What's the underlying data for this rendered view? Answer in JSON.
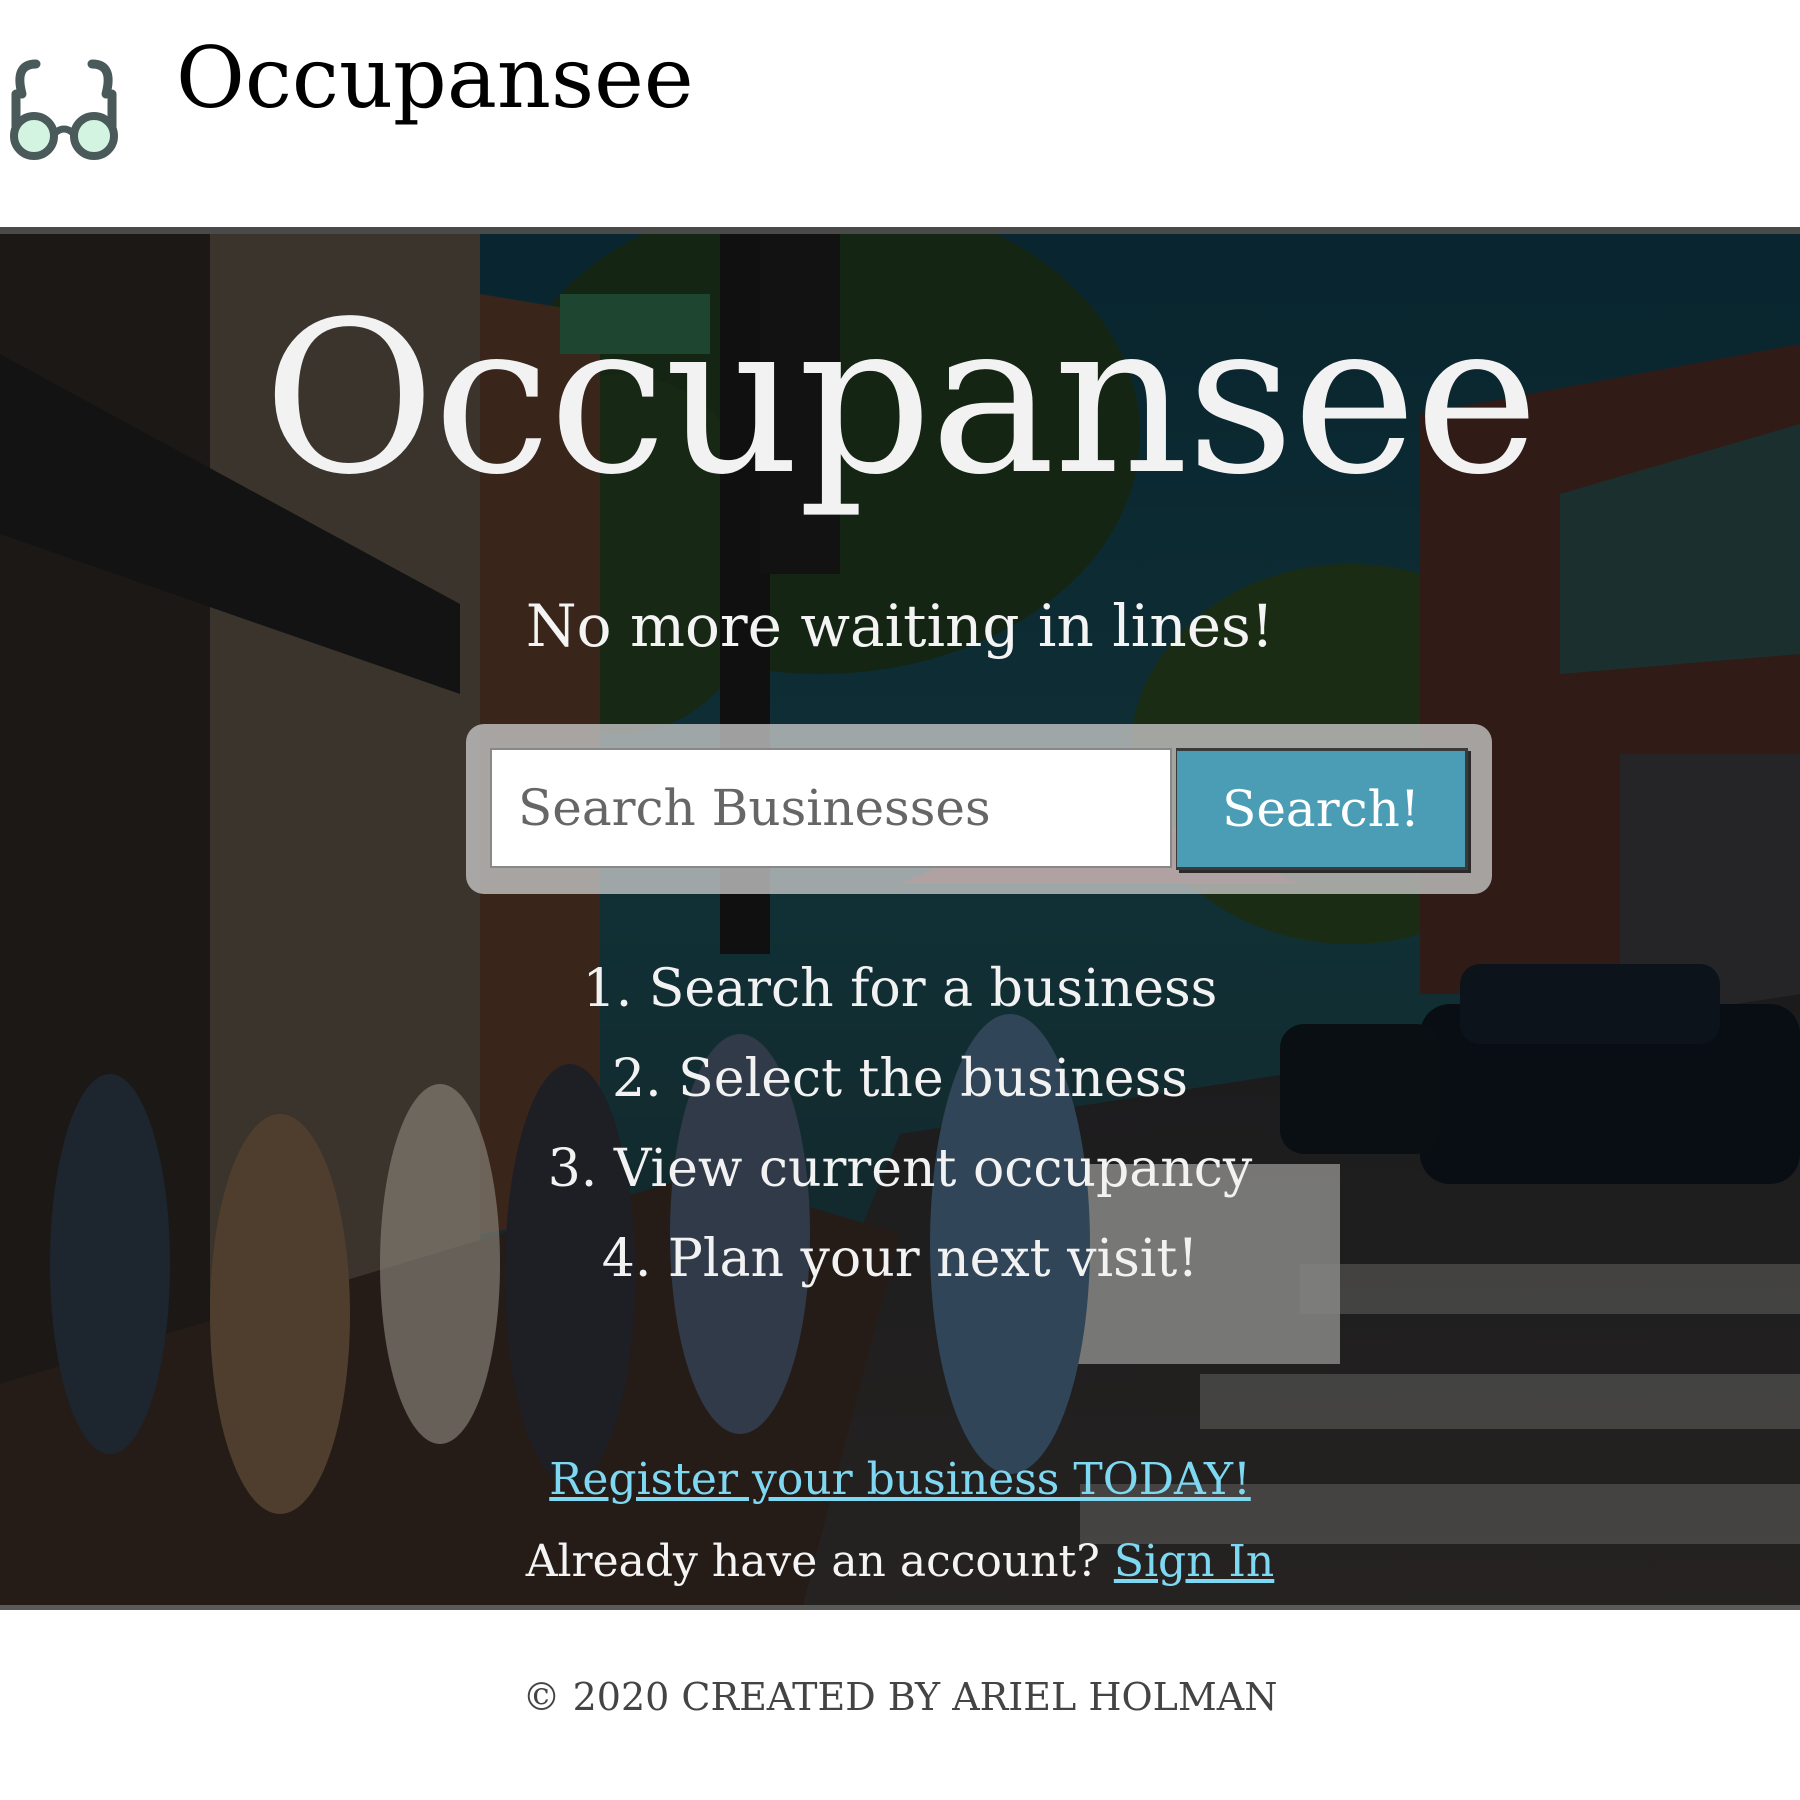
{
  "header": {
    "logo_icon": "glasses-icon",
    "brand": "Occupansee"
  },
  "hero": {
    "title": "Occupansee",
    "subtitle": "No more waiting in lines!",
    "search": {
      "placeholder": "Search Businesses",
      "value": "",
      "button_label": "Search!"
    },
    "steps": [
      "1. Search for a business",
      "2. Select the business",
      "3. View current occupancy",
      "4. Plan your next visit!"
    ],
    "register_link": "Register your business TODAY!",
    "signin_prompt": "Already have an account?",
    "signin_link": "Sign In"
  },
  "footer": {
    "copyright": "© 2020 CREATED BY ARIEL HOLMAN"
  },
  "colors": {
    "accent": "#4a9db5",
    "link": "#7fd8f2",
    "logo_lens": "#c8f0d8",
    "logo_frame": "#4a5a5a"
  }
}
